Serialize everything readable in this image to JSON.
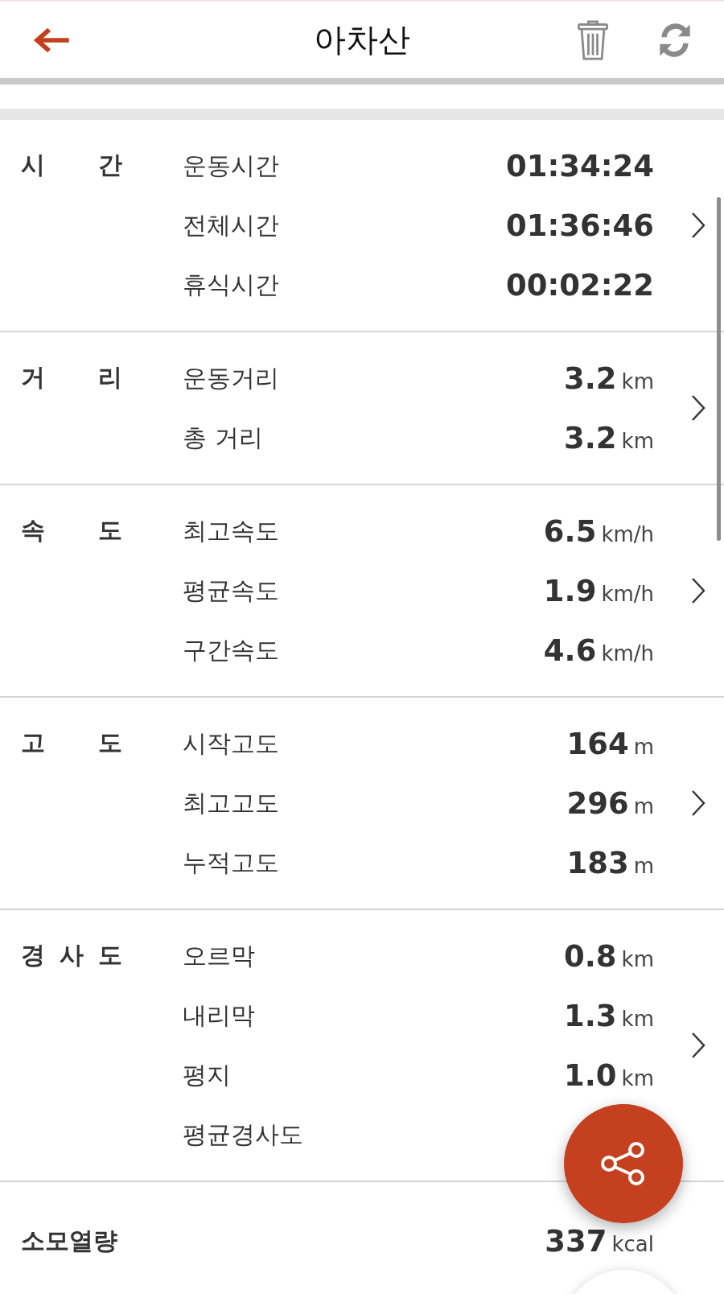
{
  "header": {
    "title": "아차산"
  },
  "sections": [
    {
      "label": "시 간",
      "rows": [
        {
          "label": "운동시간",
          "value": "01:34:24"
        },
        {
          "label": "전체시간",
          "value": "01:36:46"
        },
        {
          "label": "휴식시간",
          "value": "00:02:22"
        }
      ]
    },
    {
      "label": "거 리",
      "rows": [
        {
          "label": "운동거리",
          "value": "3.2",
          "unit": "km"
        },
        {
          "label": "총 거리",
          "value": "3.2",
          "unit": "km"
        }
      ]
    },
    {
      "label": "속 도",
      "rows": [
        {
          "label": "최고속도",
          "value": "6.5",
          "unit": "km/h"
        },
        {
          "label": "평균속도",
          "value": "1.9",
          "unit": "km/h"
        },
        {
          "label": "구간속도",
          "value": "4.6",
          "unit": "km/h"
        }
      ]
    },
    {
      "label": "고 도",
      "rows": [
        {
          "label": "시작고도",
          "value": "164",
          "unit": "m"
        },
        {
          "label": "최고고도",
          "value": "296",
          "unit": "m"
        },
        {
          "label": "누적고도",
          "value": "183",
          "unit": "m"
        }
      ]
    },
    {
      "label": "경 사 도",
      "rows": [
        {
          "label": "오르막",
          "value": "0.8",
          "unit": "km"
        },
        {
          "label": "내리막",
          "value": "1.3",
          "unit": "km"
        },
        {
          "label": "평지",
          "value": "1.0",
          "unit": "km"
        },
        {
          "label": "평균경사도"
        }
      ]
    }
  ],
  "calories": {
    "label": "소모열량",
    "value": "337",
    "unit": "kcal"
  }
}
